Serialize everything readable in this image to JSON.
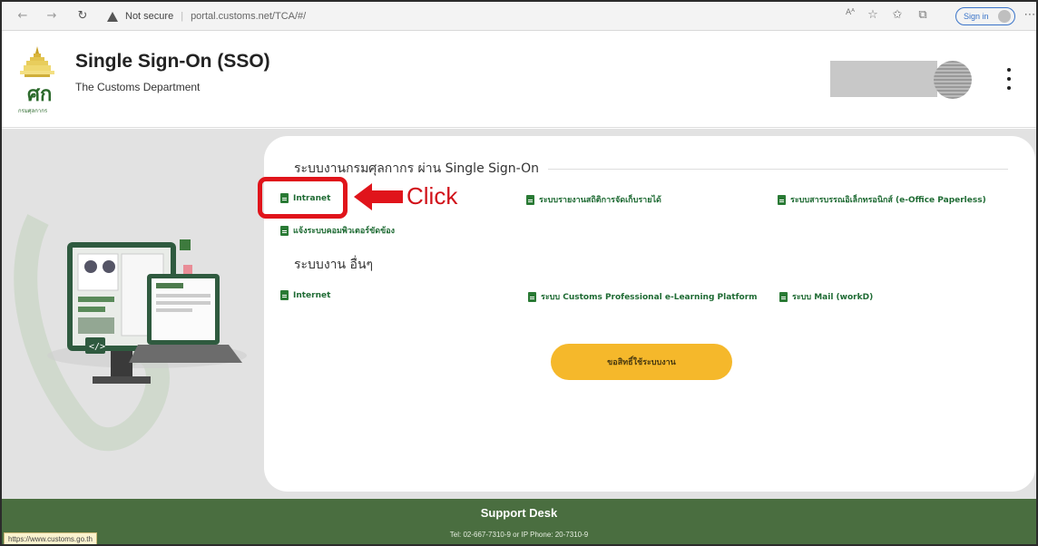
{
  "browser": {
    "security_label": "Not secure",
    "url": "portal.customs.net/TCA/#/",
    "signin_label": "Sign in",
    "read_aloud_text": "Aᴬ",
    "status_url": "https://www.customs.go.th"
  },
  "header": {
    "title": "Single Sign-On (SSO)",
    "subtitle": "The Customs Department",
    "logo_caption": "กรมศุลกากร"
  },
  "sections": {
    "sso_title": "ระบบงานกรมศุลกากร ผ่าน Single Sign-On",
    "sso_links": [
      "Intranet",
      "ระบบรายงานสถิติการจัดเก็บรายได้",
      "ระบบสารบรรณอิเล็กทรอนิกส์ (e-Office Paperless)",
      "แจ้งระบบคอมพิวเตอร์ขัดข้อง"
    ],
    "other_title": "ระบบงาน อื่นๆ",
    "other_links": [
      "Internet",
      "ระบบ Customs Professional e-Learning Platform",
      "ระบบ Mail (workD)"
    ],
    "request_button": "ขอสิทธิ์ใช้ระบบงาน"
  },
  "annotation": {
    "click_label": "Click",
    "highlight_color": "#e0141b"
  },
  "footer": {
    "title": "Support Desk",
    "contact": "Tel: 02-667-7310-9 or IP Phone: 20-7310-9"
  },
  "colors": {
    "footer_bg": "#4a6e40",
    "link_green": "#1f6b34",
    "button_yellow": "#f5b82b"
  }
}
